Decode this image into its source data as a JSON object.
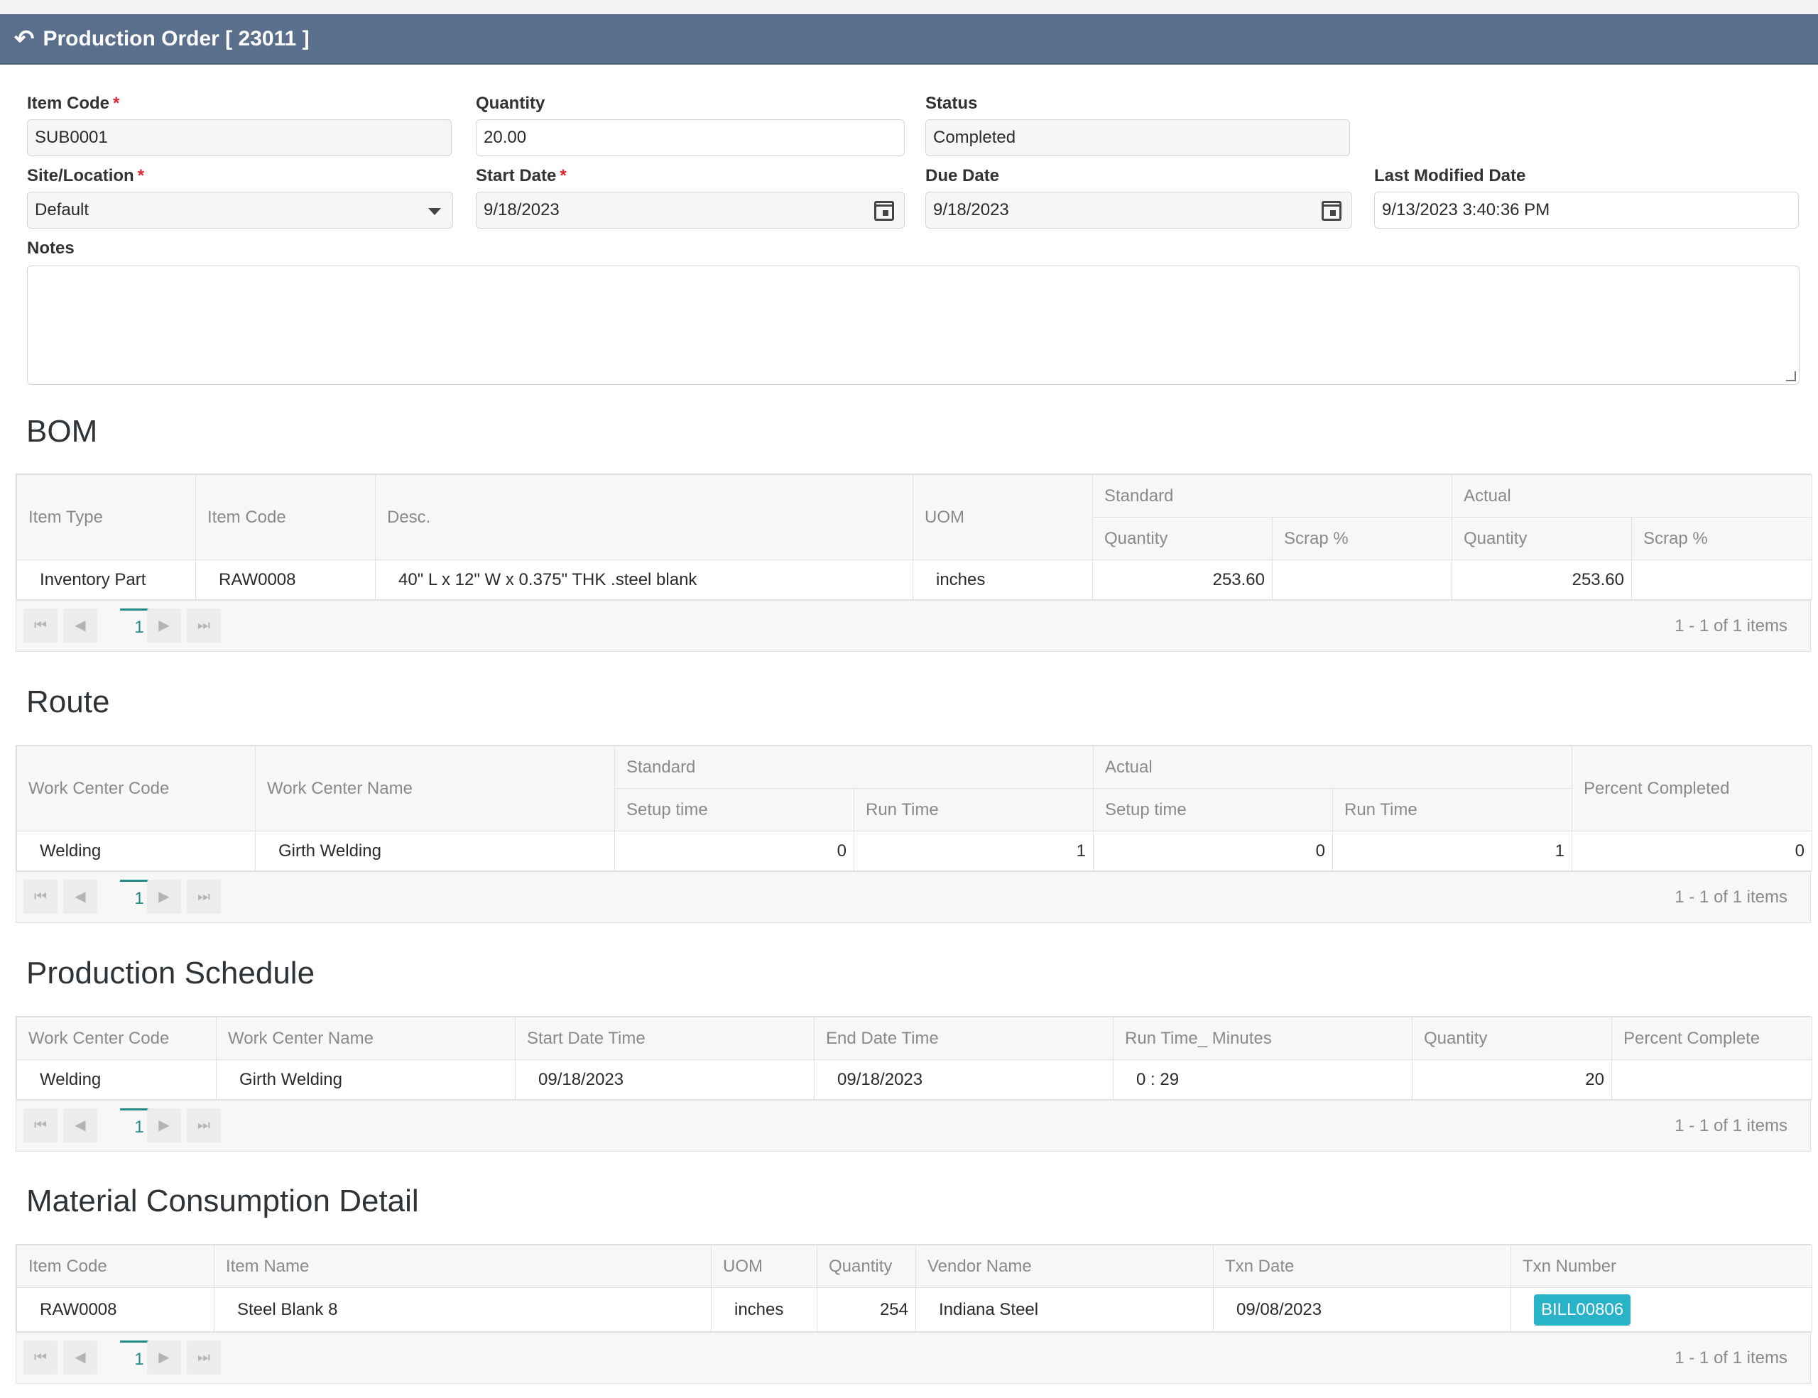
{
  "header": {
    "title": "Production Order [ 23011 ]",
    "back_icon": "undo-icon"
  },
  "form": {
    "item_code": {
      "label": "Item Code",
      "value": "SUB0001"
    },
    "quantity": {
      "label": "Quantity",
      "value": "20.00"
    },
    "status": {
      "label": "Status",
      "value": "Completed"
    },
    "site": {
      "label": "Site/Location",
      "value": "Default"
    },
    "start_date": {
      "label": "Start Date",
      "value": "9/18/2023"
    },
    "due_date": {
      "label": "Due Date",
      "value": "9/18/2023"
    },
    "last_modified": {
      "label": "Last Modified Date",
      "value": "9/13/2023 3:40:36 PM"
    },
    "notes": {
      "label": "Notes",
      "value": ""
    }
  },
  "bom": {
    "title": "BOM",
    "headers": {
      "item_type": "Item Type",
      "item_code": "Item Code",
      "desc": "Desc.",
      "uom": "UOM",
      "standard": "Standard",
      "actual": "Actual",
      "quantity": "Quantity",
      "scrap": "Scrap %"
    },
    "rows": [
      {
        "item_type": "Inventory Part",
        "item_code": "RAW0008",
        "desc": "40\" L x 12\" W x 0.375\" THK .steel blank",
        "uom": "inches",
        "std_qty": "253.60",
        "std_scrap": "",
        "act_qty": "253.60",
        "act_scrap": ""
      }
    ],
    "page": "1",
    "info": "1 - 1 of 1 items"
  },
  "route": {
    "title": "Route",
    "headers": {
      "wc_code": "Work Center Code",
      "wc_name": "Work Center Name",
      "standard": "Standard",
      "actual": "Actual",
      "setup": "Setup time",
      "run": "Run Time",
      "percent": "Percent Completed"
    },
    "rows": [
      {
        "wc_code": "Welding",
        "wc_name": "Girth Welding",
        "std_setup": "0",
        "std_run": "1",
        "act_setup": "0",
        "act_run": "1",
        "percent": "0"
      }
    ],
    "page": "1",
    "info": "1 - 1 of 1 items"
  },
  "schedule": {
    "title": "Production Schedule",
    "headers": {
      "wc_code": "Work Center Code",
      "wc_name": "Work Center Name",
      "start": "Start Date Time",
      "end": "End Date Time",
      "run": "Run Time_ Minutes",
      "qty": "Quantity",
      "percent": "Percent Complete"
    },
    "rows": [
      {
        "wc_code": "Welding",
        "wc_name": "Girth Welding",
        "start": "09/18/2023",
        "end": "09/18/2023",
        "run": "0 : 29",
        "qty": "20",
        "percent": ""
      }
    ],
    "page": "1",
    "info": "1 - 1 of 1 items"
  },
  "consumption": {
    "title": "Material Consumption Detail",
    "headers": {
      "item_code": "Item Code",
      "item_name": "Item Name",
      "uom": "UOM",
      "qty": "Quantity",
      "vendor": "Vendor Name",
      "txn_date": "Txn Date",
      "txn_number": "Txn Number"
    },
    "rows": [
      {
        "item_code": "RAW0008",
        "item_name": "Steel Blank 8",
        "uom": "inches",
        "qty": "254",
        "vendor": "Indiana Steel",
        "txn_date": "09/08/2023",
        "txn_number": "BILL00806"
      }
    ],
    "page": "1",
    "info": "1 - 1 of 1 items"
  },
  "pager_icons": [
    "first-page-icon",
    "prev-page-icon",
    "next-page-icon",
    "last-page-icon"
  ],
  "colors": {
    "header_bg": "#5a6f8c",
    "accent": "#1e8c84",
    "badge": "#29b3c9",
    "required": "#e0262f"
  }
}
